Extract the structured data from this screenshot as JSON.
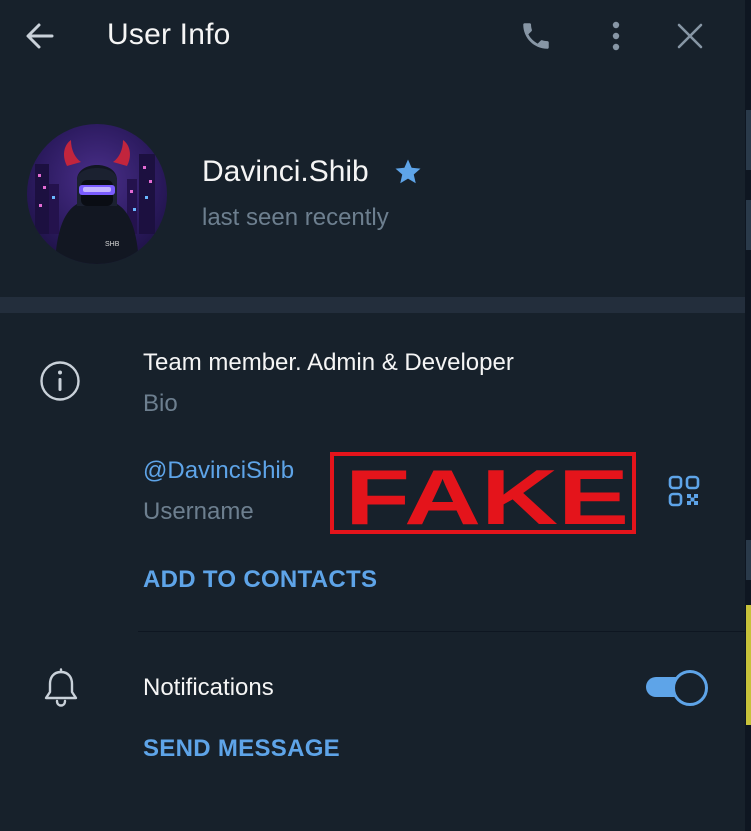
{
  "header": {
    "title": "User Info",
    "icons": [
      "back-arrow-icon",
      "phone-icon",
      "more-vertical-icon",
      "close-icon"
    ]
  },
  "profile": {
    "name": "Davinci.Shib",
    "status": "last seen recently",
    "badge_icon": "star-icon",
    "avatar_text": "SHB"
  },
  "info": {
    "bio": "Team member. Admin & Developer",
    "bio_label": "Bio",
    "username": "@DavinciShib",
    "username_label": "Username",
    "add_contacts": "ADD TO CONTACTS"
  },
  "stamp": {
    "text": "FAKE",
    "color": "#e4141b"
  },
  "notifications": {
    "label": "Notifications",
    "enabled": true
  },
  "actions": {
    "send_message": "SEND MESSAGE"
  },
  "colors": {
    "background": "#17212b",
    "accent": "#5ea4e8",
    "muted": "#6d7f8f",
    "band": "#232e3c"
  }
}
